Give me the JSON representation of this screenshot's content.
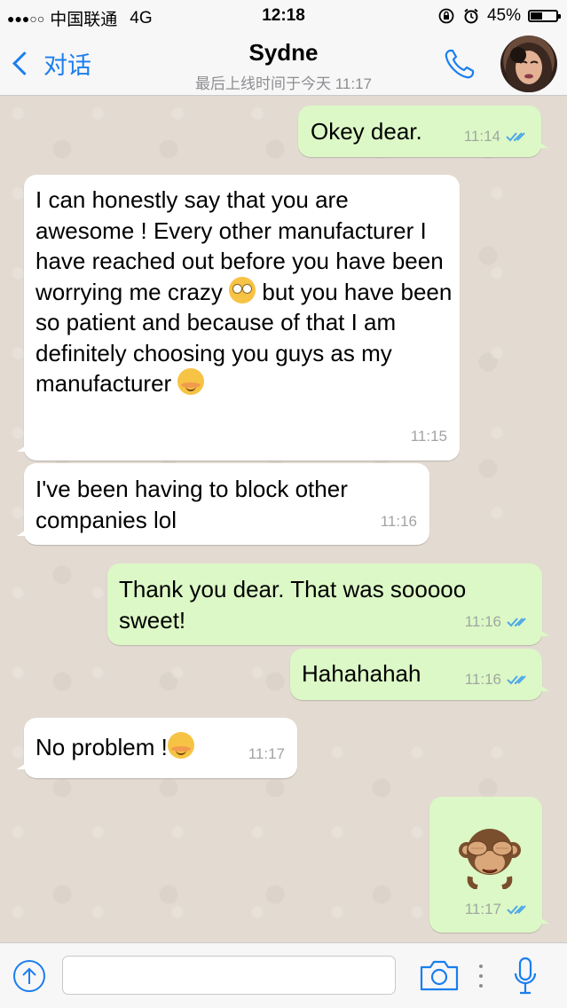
{
  "status_bar": {
    "carrier": "中国联通",
    "network": "4G",
    "time": "12:18",
    "battery": "45%",
    "battery_level": 0.45,
    "signal_icons": [
      "signal-dots-icon",
      "rotation-lock-icon",
      "alarm-icon",
      "battery-icon"
    ]
  },
  "nav": {
    "back_label": "对话",
    "contact_name": "Sydne",
    "last_seen": "最后上线时间于今天 11:17",
    "call_icon": "phone-icon",
    "avatar_icon": "contact-avatar"
  },
  "messages": [
    {
      "dir": "out",
      "text": "Okey dear.",
      "time": "11:14",
      "ticks": "read"
    },
    {
      "dir": "in",
      "text_parts": [
        "I can honestly say that you are awesome ! Every other manufacturer I have reached out before you have been worrying me crazy ",
        "rolling-eyes-emoji",
        " but you have been so patient and because of that I am definitely choosing you guys as my manufacturer ",
        "smiling-blush-emoji"
      ],
      "time": "11:15"
    },
    {
      "dir": "in",
      "text": "I've been having to block other companies lol",
      "time": "11:16"
    },
    {
      "dir": "out",
      "text": "Thank you dear. That was sooooo sweet!",
      "time": "11:16",
      "ticks": "read"
    },
    {
      "dir": "out",
      "text": "Hahahahah",
      "time": "11:16",
      "ticks": "read"
    },
    {
      "dir": "in",
      "text": "No problem !",
      "emoji": "smiling-blush-emoji",
      "time": "11:17"
    },
    {
      "dir": "out",
      "sticker": "see-no-evil-monkey-emoji",
      "time": "11:17",
      "ticks": "read"
    }
  ],
  "input_bar": {
    "placeholder": "",
    "icons": [
      "upload-arrow-icon",
      "camera-icon",
      "more-dots-icon",
      "microphone-icon"
    ]
  },
  "colors": {
    "outgoing_bubble": "#dcf8c6",
    "incoming_bubble": "#ffffff",
    "accent": "#1a7ef0",
    "read_ticks": "#4fa8e8"
  }
}
